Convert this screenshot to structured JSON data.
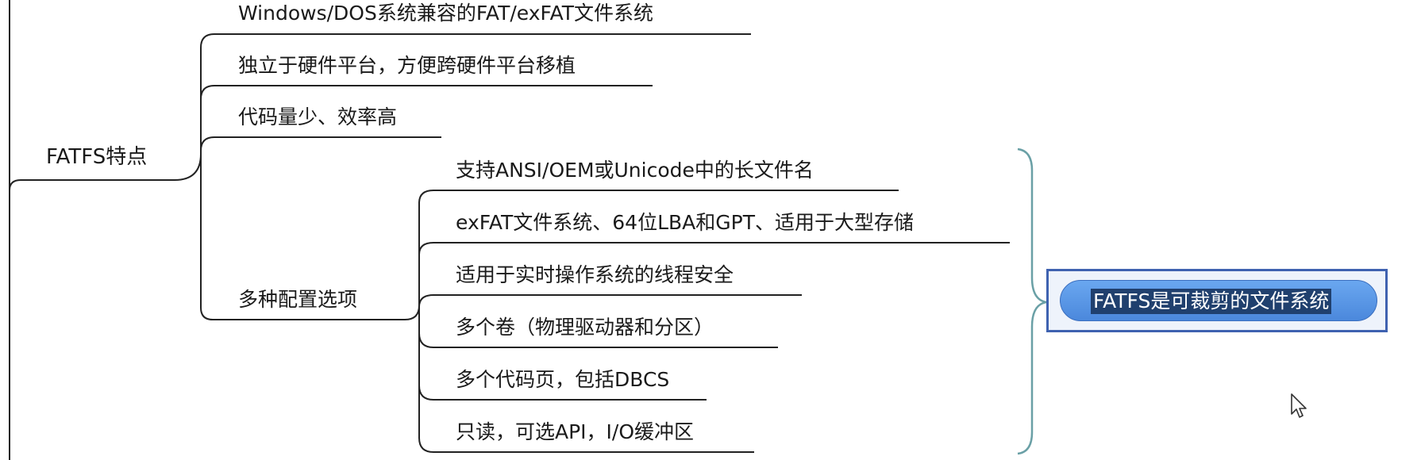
{
  "mindmap": {
    "root": {
      "label": "FATFS特点"
    },
    "branches": [
      {
        "label": "Windows/DOS系统兼容的FAT/exFAT文件系统"
      },
      {
        "label": "独立于硬件平台，方便跨硬件平台移植"
      },
      {
        "label": "代码量少、效率高"
      },
      {
        "label": "多种配置选项",
        "children": [
          {
            "label": "支持ANSI/OEM或Unicode中的长文件名"
          },
          {
            "label": "exFAT文件系统、64位LBA和GPT、适用于大型存储"
          },
          {
            "label": "适用于实时操作系统的线程安全"
          },
          {
            "label": "多个卷（物理驱动器和分区）"
          },
          {
            "label": "多个代码页，包括DBCS"
          },
          {
            "label": "只读，可选API，I/O缓冲区"
          }
        ]
      }
    ],
    "summary": {
      "label": "FATFS是可裁剪的文件系统"
    }
  },
  "colors": {
    "line": "#222222",
    "brace": "#6aa0a6",
    "bubble_border": "#3f62b0",
    "pill_fill": "#5a97e6",
    "selection": "#20406e"
  },
  "icons": {
    "cursor": "mouse-pointer-icon"
  }
}
